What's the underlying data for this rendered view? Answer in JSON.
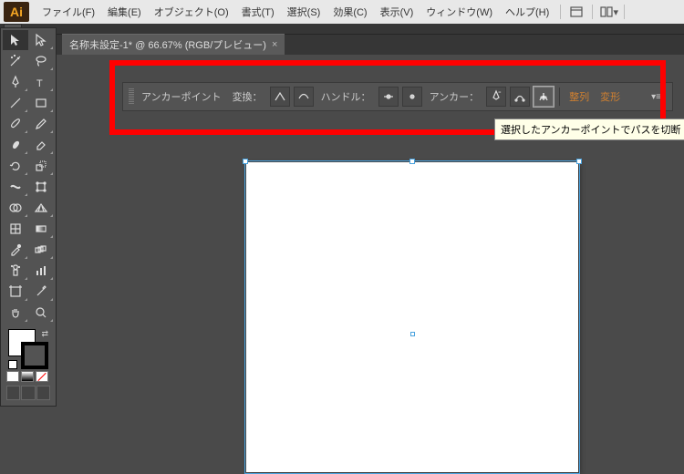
{
  "menubar": {
    "logo": "Ai",
    "items": [
      "ファイル(F)",
      "編集(E)",
      "オブジェクト(O)",
      "書式(T)",
      "選択(S)",
      "効果(C)",
      "表示(V)",
      "ウィンドウ(W)",
      "ヘルプ(H)"
    ]
  },
  "tab": {
    "title": "名称未設定-1* @ 66.67% (RGB/プレビュー)",
    "close": "×"
  },
  "control": {
    "label": "アンカーポイント",
    "convert": "変換：",
    "handle": "ハンドル：",
    "anchor": "アンカー：",
    "align": "整列",
    "transform": "変形",
    "menu": "▾≡"
  },
  "tooltip": "選択したアンカーポイントでパスを切断"
}
